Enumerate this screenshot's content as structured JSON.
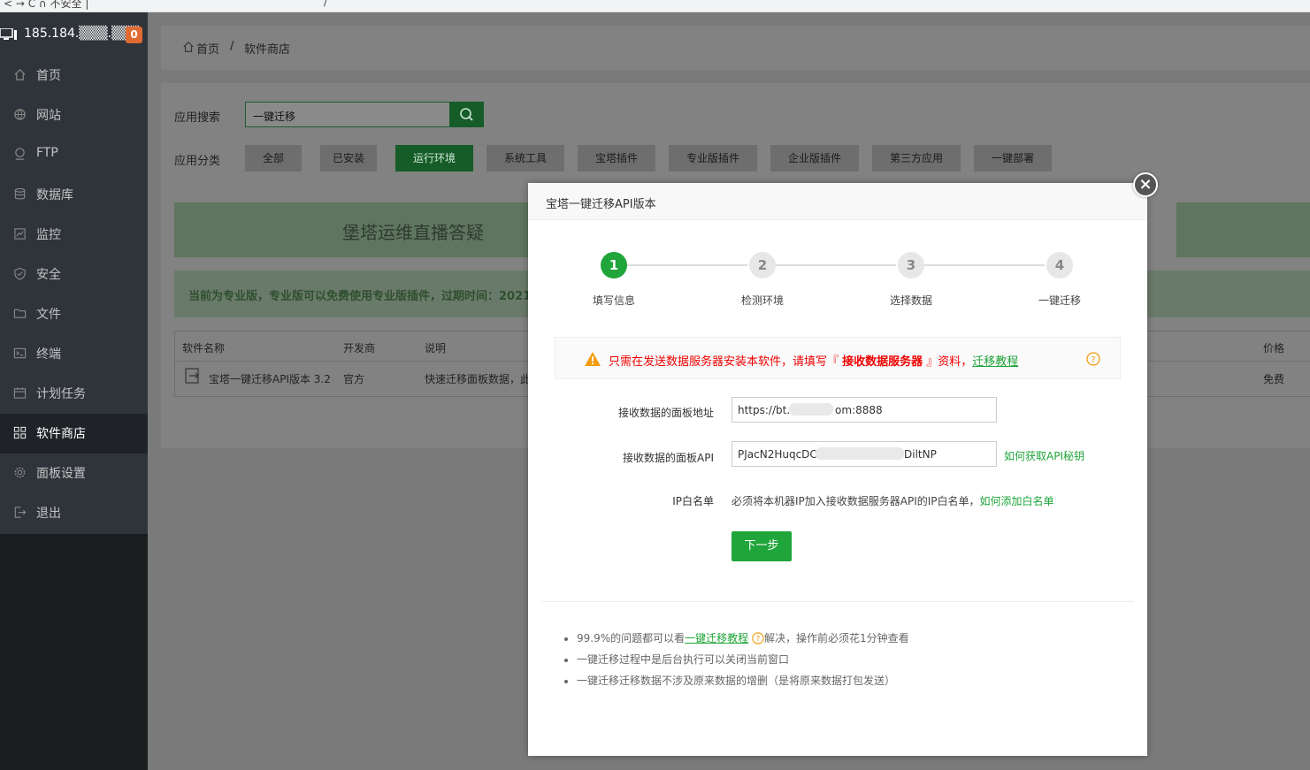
{
  "browser": {
    "frag1": "< → C ∩ 不安全 |",
    "frag2": "/"
  },
  "server": {
    "ip": "185.184.▒▒▒.▒▒▒",
    "badge": "0"
  },
  "sidebar": {
    "items": [
      {
        "label": "首页",
        "icon": "home-icon"
      },
      {
        "label": "网站",
        "icon": "globe-icon"
      },
      {
        "label": "FTP",
        "icon": "ftp-icon"
      },
      {
        "label": "数据库",
        "icon": "database-icon"
      },
      {
        "label": "监控",
        "icon": "monitor-icon"
      },
      {
        "label": "安全",
        "icon": "shield-icon"
      },
      {
        "label": "文件",
        "icon": "folder-icon"
      },
      {
        "label": "终端",
        "icon": "terminal-icon"
      },
      {
        "label": "计划任务",
        "icon": "calendar-icon"
      },
      {
        "label": "软件商店",
        "icon": "grid-icon"
      },
      {
        "label": "面板设置",
        "icon": "gear-icon"
      },
      {
        "label": "退出",
        "icon": "logout-icon"
      }
    ]
  },
  "breadcrumb": {
    "home": "首页",
    "sep": "/",
    "current": "软件商店"
  },
  "search": {
    "label": "应用搜索",
    "value": "一键迁移"
  },
  "category": {
    "label": "应用分类",
    "items": [
      "全部",
      "已安装",
      "运行环境",
      "系统工具",
      "宝塔插件",
      "专业版插件",
      "企业版插件",
      "第三方应用",
      "一键部署"
    ]
  },
  "banner": {
    "text": "堡塔运维直播答疑"
  },
  "notice": {
    "text": "当前为专业版，专业版可以免费使用专业版插件，过期时间：2021,"
  },
  "table": {
    "headers": [
      "软件名称",
      "开发商",
      "说明",
      "价格"
    ],
    "row": {
      "name": "宝塔一键迁移API版本 3.2",
      "dev": "官方",
      "desc": "快速迁移面板数据，此",
      "price": "免费"
    }
  },
  "modal": {
    "title": "宝塔一键迁移API版本",
    "close": "×",
    "steps": [
      {
        "num": "1",
        "label": "填写信息"
      },
      {
        "num": "2",
        "label": "检测环境"
      },
      {
        "num": "3",
        "label": "选择数据"
      },
      {
        "num": "4",
        "label": "一键迁移"
      }
    ],
    "warning": {
      "pre": "只需在发送数据服务器安装本软件，请填写『 ",
      "bold": "接收数据服务器",
      "mid": " 』资料，",
      "link": "迁移教程"
    },
    "form": {
      "url_label": "接收数据的面板地址",
      "url_pre": "https://bt.",
      "url_post": "om:8888",
      "api_label": "接收数据的面板API",
      "api_pre": "PJacN2HuqcDC",
      "api_post": "DiltNP",
      "api_link": "如何获取API秘钥",
      "ip_label": "IP白名单",
      "ip_tip": "必须将本机器IP加入接收数据服务器API的IP白名单，",
      "ip_link": "如何添加白名单"
    },
    "next": "下一步",
    "notes": {
      "n1_pre": "99.9%的问题都可以看",
      "n1_link": "一键迁移教程",
      "n1_post": "解决，操作前必须花1分钟查看",
      "n2": "一键迁移过程中是后台执行可以关闭当前窗口",
      "n3": "一键迁移迁移数据不涉及原来数据的增删（是将原来数据打包发送）"
    }
  },
  "colors": {
    "accent": "#20a53a",
    "warning": "#e00000",
    "sidebar": "#2f343a"
  }
}
